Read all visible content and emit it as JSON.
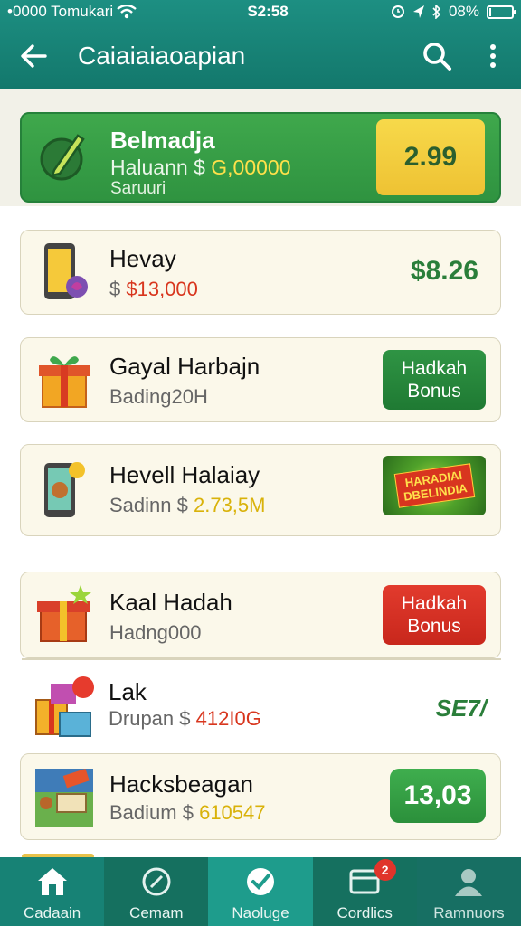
{
  "status": {
    "carrier": "•0000 Tomukari",
    "time": "S2:58",
    "battery": "08%",
    "battery_level": 0.08
  },
  "appbar": {
    "title": "Caiaiaiaoapian"
  },
  "balance": {
    "name": "Belmadja",
    "label": "Haluann $",
    "amount": "G,00000",
    "sub": "Saruuri",
    "score": "2.99"
  },
  "items": [
    {
      "title": "Hevay",
      "sub_prefix": "$",
      "sub_amount": "$13,000",
      "value": "$8.26"
    },
    {
      "title": "Gayal Harbajn",
      "sub": "Bading20H",
      "button": "Hadkah\nBonus"
    },
    {
      "title": "Hevell Halaiay",
      "sub_prefix": "Sadinn $",
      "sub_amount": "2.73,5M",
      "promo": "HARADIAI\nDBELINDIA"
    },
    {
      "title": "Kaal Hadah",
      "sub": "Hadng000",
      "button": "Hadkah\nBonus"
    },
    {
      "title": "Lak",
      "sub_prefix": "Drupan $",
      "sub_amount": "412I0G",
      "value": "SE7/"
    },
    {
      "title": "Hacksbeagan",
      "sub_prefix": "Badium $",
      "sub_amount": "610547",
      "value": "13,03"
    }
  ],
  "nav": [
    {
      "label": "Cadaain",
      "icon": "home-icon"
    },
    {
      "label": "Cemam",
      "icon": "search-circle-icon"
    },
    {
      "label": "Naoluge",
      "icon": "check-circle-icon"
    },
    {
      "label": "Cordlics",
      "icon": "inbox-icon",
      "badge": "2"
    },
    {
      "label": "Ramnuors",
      "icon": "user-icon"
    }
  ]
}
